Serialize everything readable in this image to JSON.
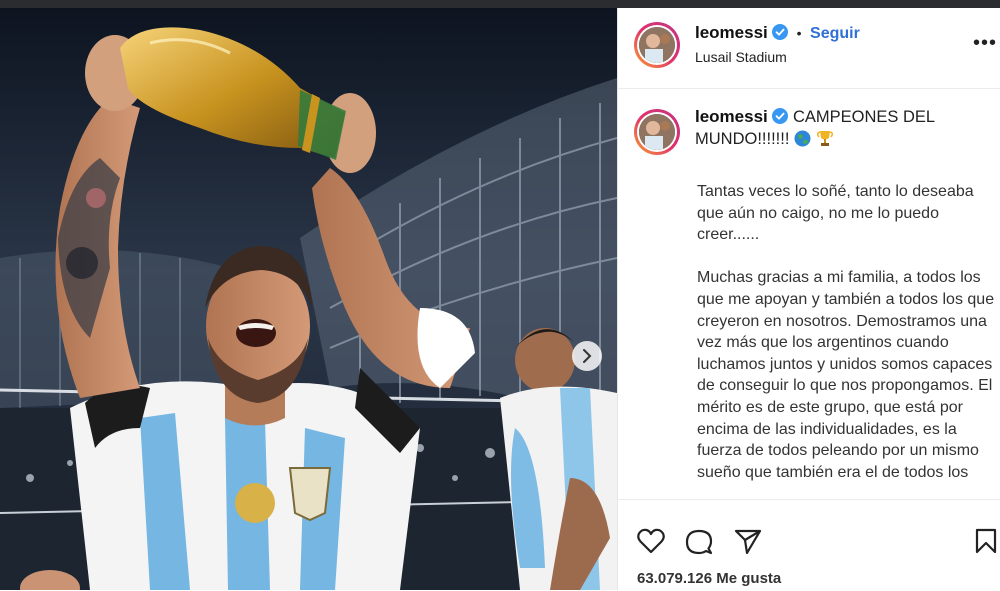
{
  "post": {
    "username": "leomessi",
    "follow_label": "Seguir",
    "location": "Lusail Stadium",
    "more_label": "•••",
    "separator": "•",
    "caption_title": "CAMPEONES DEL MUNDO!!!!!!!",
    "caption_paragraphs": [
      "Tantas veces lo soñé, tanto lo deseaba que aún no caigo, no me lo puedo creer......",
      "Muchas gracias a mi familia, a todos los que me apoyan y también a todos los que creyeron en nosotros. Demostramos una vez más que los argentinos cuando luchamos juntos y unidos somos capaces de conseguir lo que nos propongamos. El mérito es de este grupo, que está por encima de las individualidades, es la fuerza de todos peleando por un mismo sueño que también era el de todos los"
    ],
    "likes": "63.079.126 Me gusta"
  },
  "icons": {
    "verified": "verified-badge-icon",
    "globe": "globe-emoji-icon",
    "trophy": "trophy-emoji-icon",
    "like": "heart-icon",
    "comment": "comment-icon",
    "share": "paper-plane-icon",
    "save": "bookmark-icon",
    "next": "chevron-right-icon"
  },
  "colors": {
    "accent": "#2f6fd6",
    "verified": "#3897f0"
  }
}
